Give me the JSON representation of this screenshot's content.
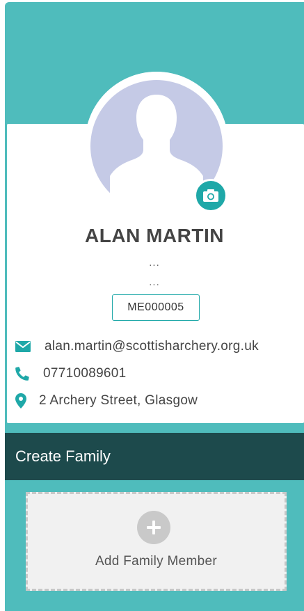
{
  "profile": {
    "name": "ALAN MARTIN",
    "line1": "...",
    "line2": "...",
    "member_id": "ME000005",
    "email": "alan.martin@scottisharchery.org.uk",
    "phone": "07710089601",
    "address": "2 Archery Street, Glasgow"
  },
  "family": {
    "header": "Create Family",
    "add_label": "Add Family Member"
  },
  "icons": {
    "camera": "camera-icon",
    "email": "envelope-icon",
    "phone": "phone-icon",
    "address": "map-pin-icon",
    "add": "plus-icon"
  },
  "colors": {
    "background_teal": "#4fbcbc",
    "accent": "#1fa8a8",
    "header_dark": "#1d4a4c",
    "avatar_placeholder": "#c5cae6"
  }
}
